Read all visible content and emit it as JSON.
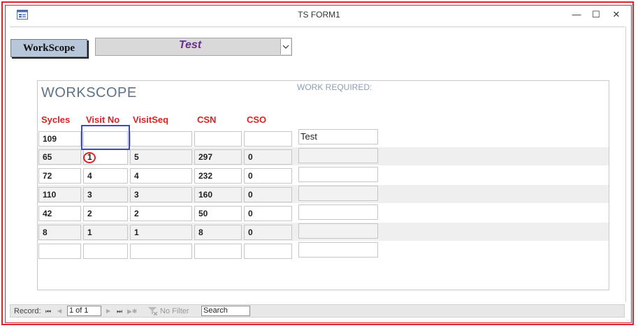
{
  "window": {
    "title": "TS FORM1",
    "minimize": "—",
    "maximize": "☐",
    "close": "✕"
  },
  "header": {
    "workscope_button": "WorkScope",
    "combo_value": "Test",
    "combo_arrow": "⌵"
  },
  "subform": {
    "title": "WORKSCOPE",
    "work_required_label": "WORK REQUIRED:",
    "columns": [
      "Sycles",
      "Visit No",
      "VisitSeq",
      "CSN",
      "CSO"
    ],
    "rows": [
      {
        "sycles": "109",
        "visit_no": "",
        "visitseq": "",
        "csn": "",
        "cso": "",
        "work_required": "Test"
      },
      {
        "sycles": "65",
        "visit_no": "1",
        "visitseq": "5",
        "csn": "297",
        "cso": "0",
        "work_required": ""
      },
      {
        "sycles": "72",
        "visit_no": "4",
        "visitseq": "4",
        "csn": "232",
        "cso": "0",
        "work_required": ""
      },
      {
        "sycles": "110",
        "visit_no": "3",
        "visitseq": "3",
        "csn": "160",
        "cso": "0",
        "work_required": ""
      },
      {
        "sycles": "42",
        "visit_no": "2",
        "visitseq": "2",
        "csn": "50",
        "cso": "0",
        "work_required": ""
      },
      {
        "sycles": "8",
        "visit_no": "1",
        "visitseq": "1",
        "csn": "8",
        "cso": "0",
        "work_required": ""
      },
      {
        "sycles": "",
        "visit_no": "",
        "visitseq": "",
        "csn": "",
        "cso": "",
        "work_required": ""
      }
    ]
  },
  "navigation": {
    "record_label": "Record:",
    "first": "⏮",
    "prev": "◀",
    "position": "1 of 1",
    "next": "▶",
    "last": "⏭",
    "new": "▶✱",
    "filter_label": "No Filter",
    "search_placeholder": "Search"
  },
  "colors": {
    "header_red": "#e02020",
    "focus_blue": "#3f48cc",
    "border_red": "#d9232d",
    "combo_text": "#6b2f8f"
  }
}
